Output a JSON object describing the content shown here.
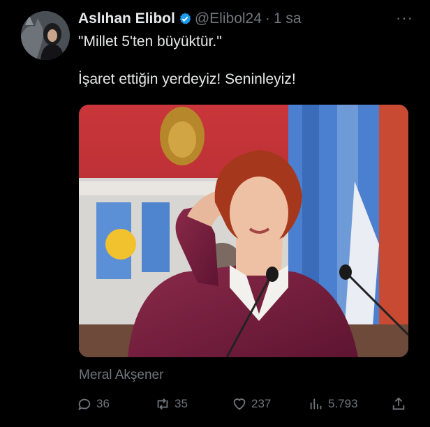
{
  "tweet": {
    "author_name": "Aslıhan Elibol",
    "handle": "@Elibol24",
    "separator": "·",
    "time": "1 sa",
    "more_label": "···",
    "text_line1": "\"Millet 5'ten büyüktür.\"",
    "text_line2": "İşaret ettiğin yerdeyiz! Seninleyiz!",
    "media_caption": "Meral Akşener"
  },
  "actions": {
    "replies": "36",
    "retweets": "35",
    "likes": "237",
    "views": "5.793"
  },
  "icons": {
    "verified": "verified-badge-icon",
    "reply": "reply-icon",
    "retweet": "retweet-icon",
    "like": "heart-icon",
    "views": "views-icon",
    "share": "share-icon",
    "more": "more-icon"
  },
  "colors": {
    "background": "#000000",
    "text": "#e7e9ea",
    "muted": "#71767b",
    "verified": "#1d9bf0"
  }
}
